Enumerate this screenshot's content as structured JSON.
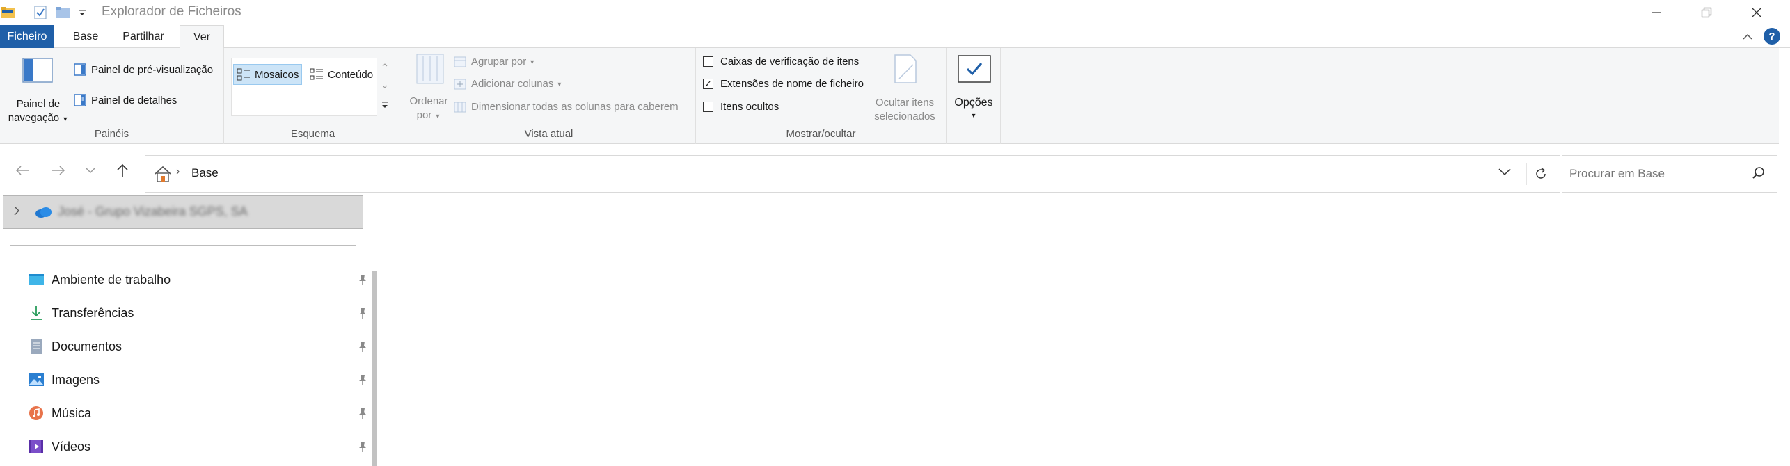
{
  "window": {
    "title": "Explorador de Ficheiros"
  },
  "tabs": [
    {
      "label": "Ficheiro"
    },
    {
      "label": "Base"
    },
    {
      "label": "Partilhar"
    },
    {
      "label": "Ver"
    }
  ],
  "ribbon": {
    "panes": {
      "nav_pane_line1": "Painel de",
      "nav_pane_line2": "navegação",
      "preview_pane": "Painel de pré-visualização",
      "details_pane": "Painel de detalhes",
      "label": "Painéis"
    },
    "layout": {
      "tiles": "Mosaicos",
      "content": "Conteúdo",
      "label": "Esquema"
    },
    "current_view": {
      "sort_line1": "Ordenar",
      "sort_line2": "por",
      "group_by": "Agrupar por",
      "add_columns": "Adicionar colunas",
      "size_all_columns": "Dimensionar todas as colunas para caberem",
      "label": "Vista atual"
    },
    "show_hide": {
      "item_checkboxes": "Caixas de verificação de itens",
      "item_checkboxes_checked": false,
      "file_extensions": "Extensões de nome de ficheiro",
      "file_extensions_checked": true,
      "hidden_items": "Itens ocultos",
      "hidden_items_checked": false,
      "hide_selected_line1": "Ocultar itens",
      "hide_selected_line2": "selecionados",
      "label": "Mostrar/ocultar"
    },
    "options": {
      "label": "Opções"
    }
  },
  "address": {
    "breadcrumb": "Base",
    "search_placeholder": "Procurar em Base"
  },
  "sidebar": {
    "cloud_item": "José - Grupo Vizabeira SGPS, SA",
    "items": [
      {
        "label": "Ambiente de trabalho",
        "icon": "desktop-icon"
      },
      {
        "label": "Transferências",
        "icon": "download-icon"
      },
      {
        "label": "Documentos",
        "icon": "documents-icon"
      },
      {
        "label": "Imagens",
        "icon": "pictures-icon"
      },
      {
        "label": "Música",
        "icon": "music-icon"
      },
      {
        "label": "Vídeos",
        "icon": "videos-icon"
      }
    ]
  },
  "colors": {
    "accent": "#1f5fa8",
    "selection": "#cce4f7",
    "folder": "#f2c14e"
  }
}
